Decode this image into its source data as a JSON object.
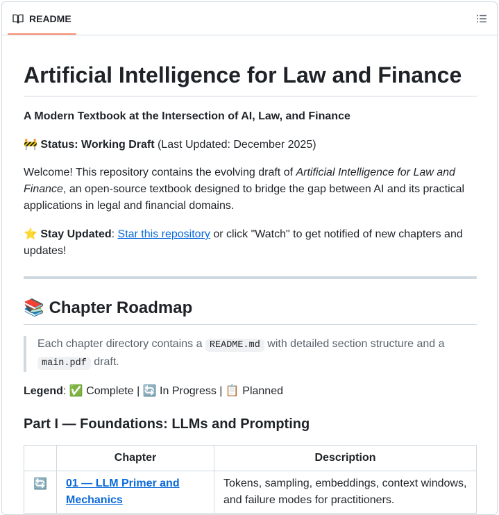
{
  "tab": {
    "icon": "book-icon",
    "label": "README"
  },
  "outline_button": {
    "icon": "list-unordered-icon"
  },
  "readme": {
    "title": "Artificial Intelligence for Law and Finance",
    "subtitle": "A Modern Textbook at the Intersection of AI, Law, and Finance",
    "status": {
      "emoji": "🚧",
      "label": "Status: Working Draft",
      "detail": " (Last Updated: December 2025)"
    },
    "welcome": {
      "before": "Welcome! This repository contains the evolving draft of ",
      "italic": "Artificial Intelligence for Law and Finance",
      "after": ", an open-source textbook designed to bridge the gap between AI and its practical applications in legal and financial domains."
    },
    "stay_updated": {
      "emoji": "⭐",
      "label": "Stay Updated",
      "colon": ": ",
      "link": "Star this repository",
      "after": " or click \"Watch\" to get notified of new chapters and updates!"
    },
    "roadmap": {
      "emoji": "📚",
      "heading": "Chapter Roadmap",
      "note_before": "Each chapter directory contains a ",
      "note_code1": "README.md",
      "note_mid": " with detailed section structure and a ",
      "note_code2": "main.pdf",
      "note_after": " draft."
    },
    "legend": {
      "label": "Legend",
      "text": ": ✅ Complete | 🔄 In Progress | 📋 Planned"
    },
    "part1": {
      "heading": "Part I — Foundations: LLMs and Prompting",
      "columns": [
        "",
        "Chapter",
        "Description"
      ],
      "rows": [
        {
          "status": "🔄",
          "chapter": "01 — LLM Primer and Mechanics",
          "description": "Tokens, sampling, embeddings, context windows, and failure modes for practitioners."
        }
      ]
    }
  }
}
